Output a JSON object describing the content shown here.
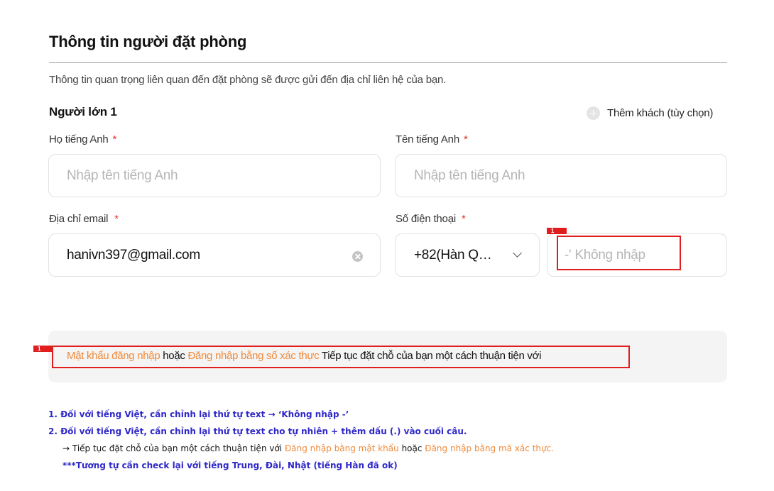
{
  "section": {
    "title": "Thông tin người đặt phòng",
    "subtitle": "Thông tin quan trọng liên quan đến đặt phòng sẽ được gửi đến địa chỉ liên hệ của bạn.",
    "adult_label": "Người lớn 1",
    "add_guest_label": "Thêm khách (tùy chọn)"
  },
  "form": {
    "last_name": {
      "label": "Họ tiếng Anh",
      "required_mark": "*",
      "placeholder": "Nhập tên tiếng Anh"
    },
    "first_name": {
      "label": "Tên tiếng Anh",
      "required_mark": "*",
      "placeholder": "Nhập tên tiếng Anh"
    },
    "email": {
      "label": "Địa chỉ email",
      "required_mark": "*",
      "value": "hanivn397@gmail.com"
    },
    "phone": {
      "label": "Số điện thoại",
      "required_mark": "*",
      "country_code": "+82(Hàn Q…",
      "placeholder": "-' Không nhập"
    }
  },
  "annotation_tags": {
    "tag1": "1",
    "tag2": "1"
  },
  "banner": {
    "part1": "Mật khẩu đăng nhập",
    "part2": " hoặc ",
    "part3": "Đăng nhập bằng số xác thực",
    "part4": " Tiếp tục đặt chỗ của bạn một cách thuận tiện với"
  },
  "notes": {
    "n1": "1. Đối với tiếng Việt, cần chỉnh lại thứ tự text → ‘Không nhập -’",
    "n2": "2. Đối với tiếng Việt, cần chỉnh lại thứ tự text cho tự nhiên + thêm dấu (.) vào cuối câu.",
    "n3_a": "→ Tiếp tục đặt chỗ của bạn một cách thuận tiện với ",
    "n3_b": "Đăng nhập bằng mật khẩu",
    "n3_c": " hoặc ",
    "n3_d": "Đăng nhập bằng mã xác thực.",
    "n4": "***Tương tự cần check lại với tiếng Trung, Đài, Nhật (tiếng Hàn đã ok)"
  }
}
